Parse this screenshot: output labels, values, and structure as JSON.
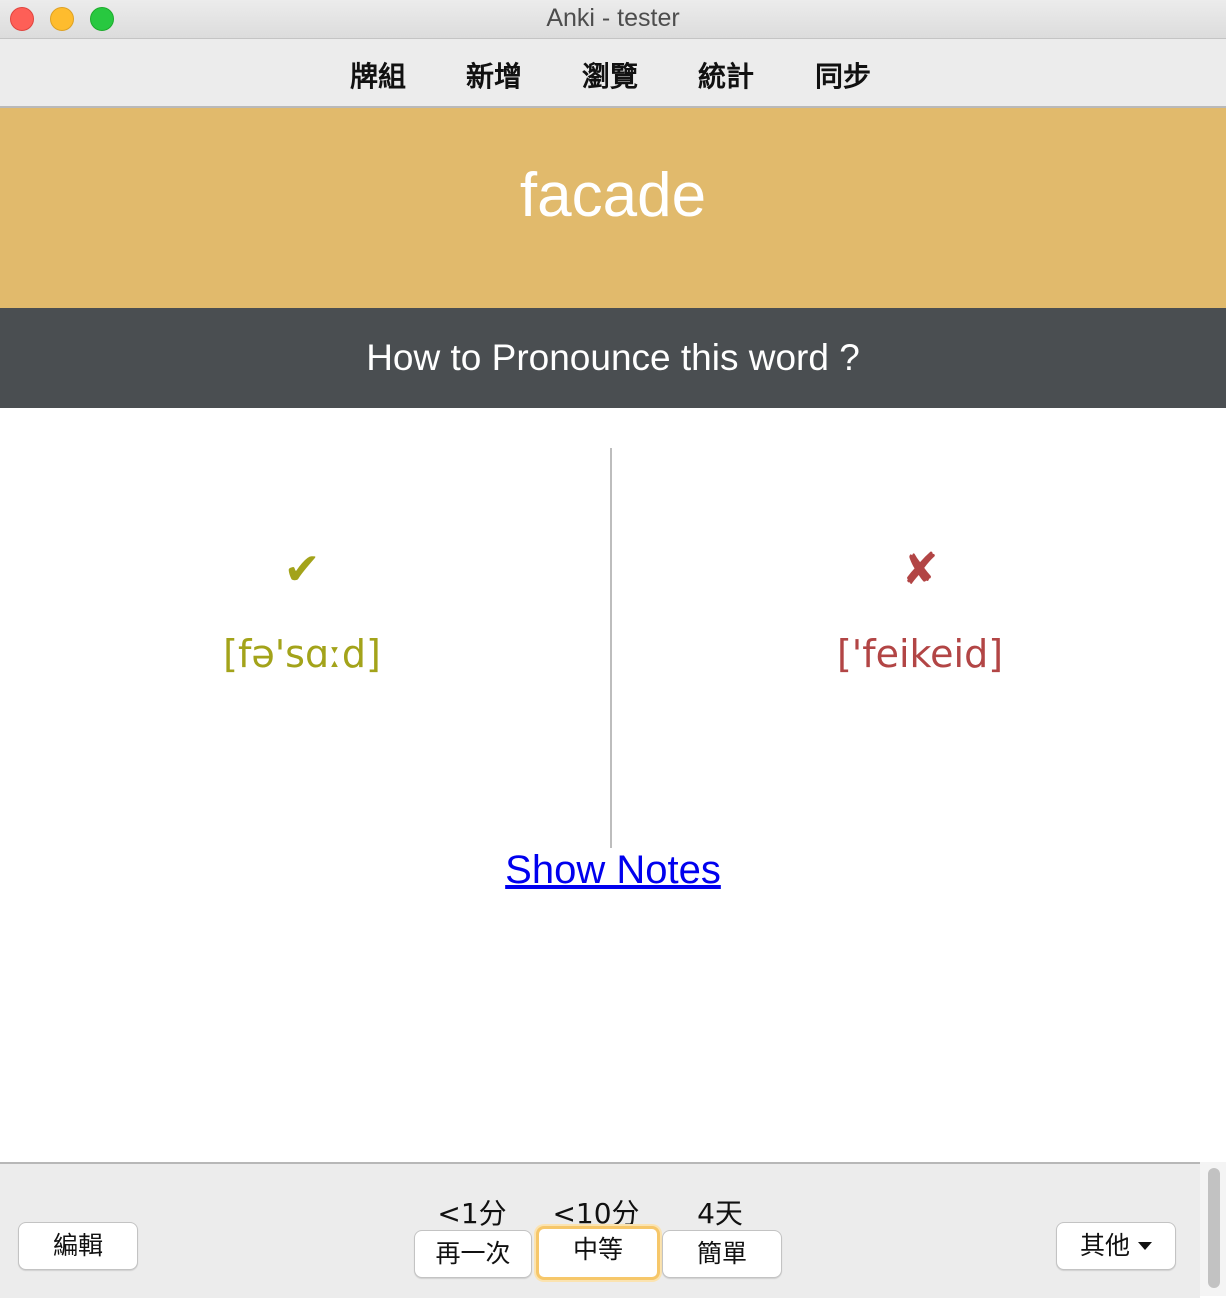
{
  "window": {
    "title": "Anki - tester"
  },
  "toolbar": {
    "items": [
      "牌組",
      "新增",
      "瀏覽",
      "統計",
      "同步"
    ]
  },
  "card": {
    "word": "facade",
    "question": "How to Pronounce this word ?",
    "correct": {
      "icon": "check-icon",
      "symbol": "✔",
      "ipa": "[fə'sɑːd]",
      "color": "#a3a31a"
    },
    "wrong": {
      "icon": "cross-icon",
      "symbol": "✘",
      "ipa": "['feikeid]",
      "color": "#b24545"
    },
    "show_notes": "Show Notes"
  },
  "colors": {
    "banner": "#e1ba6c",
    "question_bar": "#4a4e51"
  },
  "bottom": {
    "edit": "編輯",
    "answers": [
      {
        "interval": "<1分",
        "label": "再一次"
      },
      {
        "interval": "<10分",
        "label": "中等"
      },
      {
        "interval": "4天",
        "label": "簡單"
      }
    ],
    "more": "其他"
  }
}
